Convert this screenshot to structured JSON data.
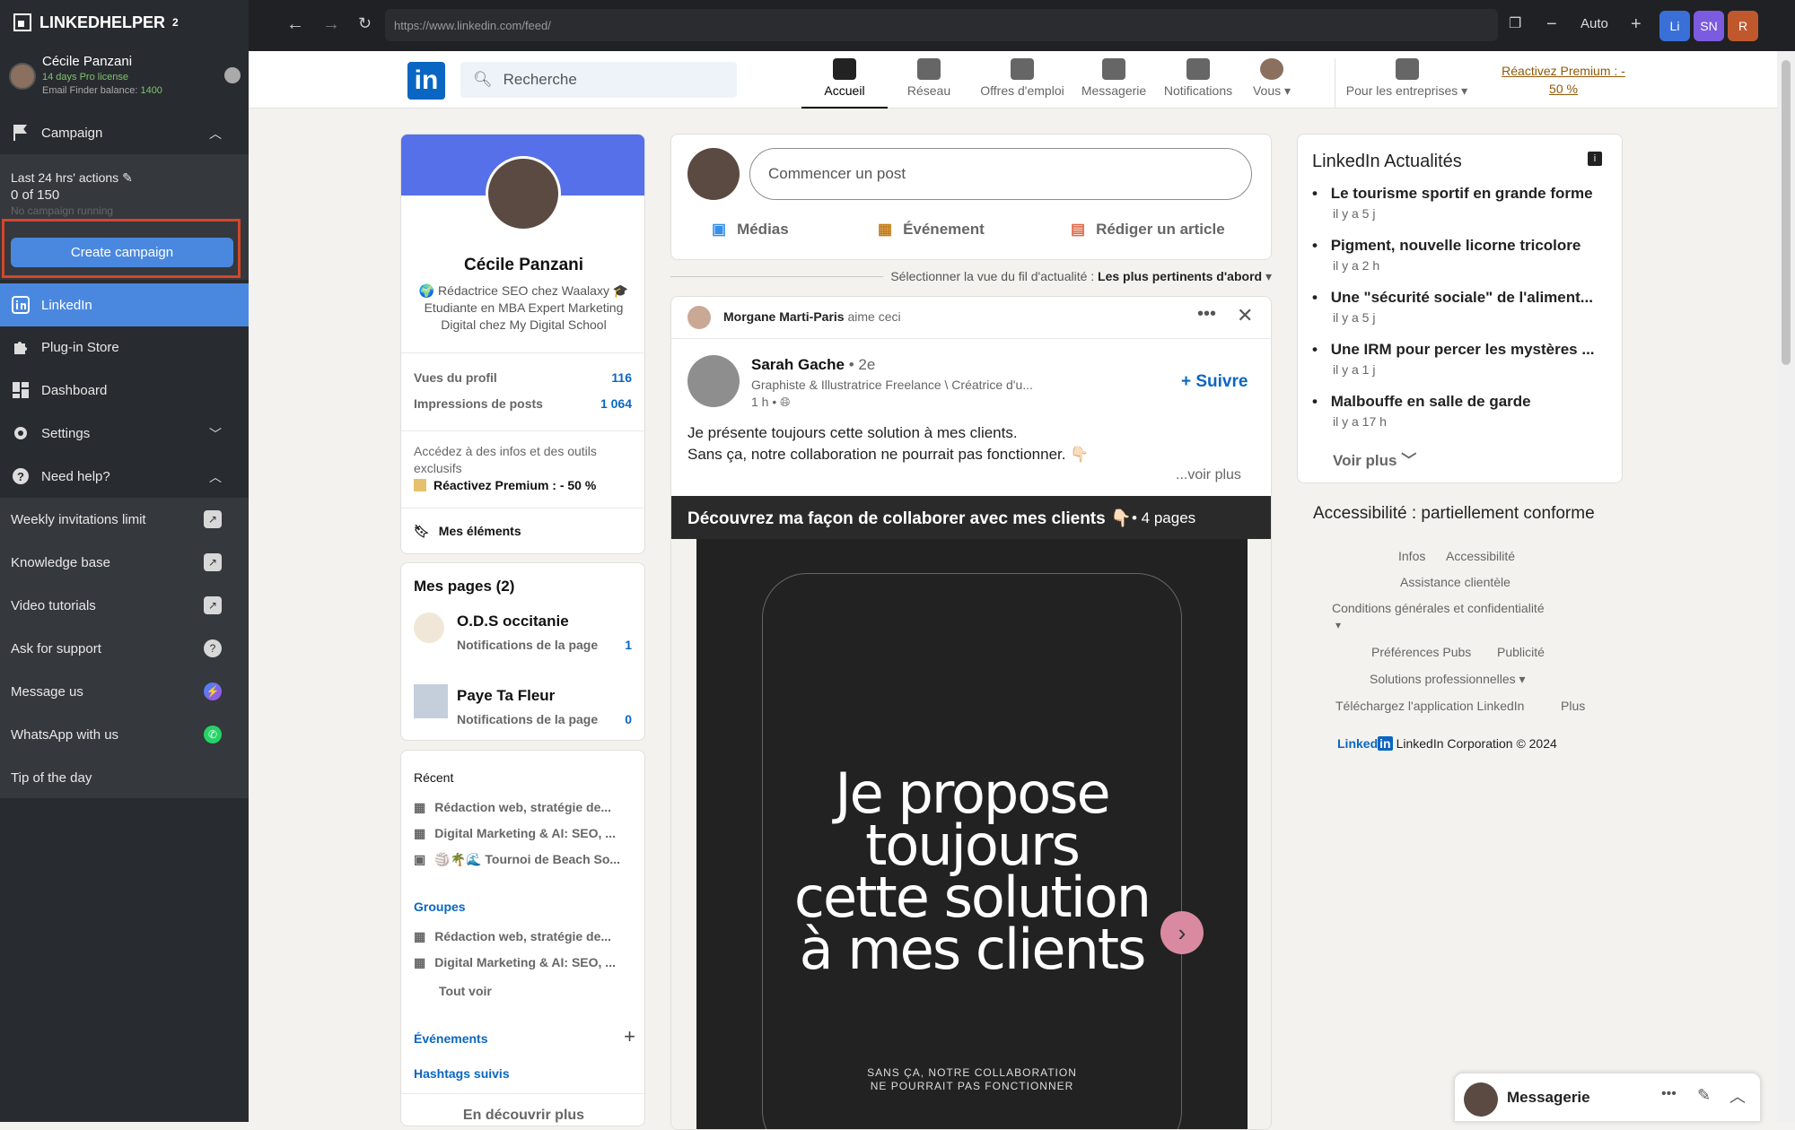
{
  "sidebar": {
    "brand": "LINKEDHELPER",
    "brand_sup": "2",
    "user_name": "Cécile Panzani",
    "license": "14 days Pro license",
    "balance_label": "Email Finder balance: ",
    "balance_value": "1400",
    "campaign_label": "Campaign",
    "stats_title": "Last 24 hrs' actions",
    "stats_count": "0 of 150",
    "stats_status": "No campaign running",
    "create_button": "Create campaign",
    "items": [
      {
        "label": "LinkedIn"
      },
      {
        "label": "Plug-in Store"
      },
      {
        "label": "Dashboard"
      },
      {
        "label": "Settings"
      },
      {
        "label": "Need help?"
      }
    ],
    "links": [
      {
        "label": "Weekly invitations limit"
      },
      {
        "label": "Knowledge base"
      },
      {
        "label": "Video tutorials"
      },
      {
        "label": "Ask for support"
      },
      {
        "label": "Message us"
      },
      {
        "label": "WhatsApp with us"
      },
      {
        "label": "Tip of the day"
      }
    ]
  },
  "browser": {
    "url": "https://www.linkedin.com/feed/",
    "zoom_mode": "Auto",
    "profiles": [
      "Li",
      "SN",
      "R"
    ],
    "profile_colors": [
      "#3a6fd8",
      "#7b5be0",
      "#c0582e"
    ]
  },
  "linkedin": {
    "search_placeholder": "Recherche",
    "nav": [
      "Accueil",
      "Réseau",
      "Offres d'emploi",
      "Messagerie",
      "Notifications",
      "Vous",
      "Pour les entreprises"
    ],
    "premium_cta": "Réactivez Premium : - 50 %",
    "profile": {
      "name": "Cécile Panzani",
      "headline": "🌍 Rédactrice SEO chez Waalaxy 🎓 Etudiante en MBA Expert Marketing Digital chez My Digital School",
      "stats": [
        {
          "label": "Vues du profil",
          "value": "116"
        },
        {
          "label": "Impressions de posts",
          "value": "1 064"
        }
      ],
      "premium_text": "Accédez à des infos et des outils exclusifs",
      "premium_link": "Réactivez Premium : - 50 %",
      "my_items": "Mes éléments"
    },
    "pages": {
      "title": "Mes pages (2)",
      "items": [
        {
          "name": "O.D.S occitanie",
          "sub": "Notifications de la page",
          "count": "1"
        },
        {
          "name": "Paye Ta Fleur",
          "sub": "Notifications de la page",
          "count": "0"
        }
      ]
    },
    "recent": {
      "title": "Récent",
      "items": [
        "Rédaction web, stratégie de...",
        "Digital Marketing & AI: SEO, ...",
        "🏐🌴🌊 Tournoi de Beach So..."
      ],
      "groups_title": "Groupes",
      "groups": [
        "Rédaction web, stratégie de...",
        "Digital Marketing & AI: SEO, ..."
      ],
      "see_all": "Tout voir",
      "events": "Événements",
      "hashtags": "Hashtags suivis",
      "discover": "En découvrir plus"
    },
    "composer": {
      "placeholder": "Commencer un post",
      "media": "Médias",
      "event": "Événement",
      "article": "Rédiger un article"
    },
    "sort": {
      "label": "Sélectionner la vue du fil d'actualité : ",
      "value": "Les plus pertinents d'abord"
    },
    "post": {
      "liker": "Morgane Marti-Paris",
      "liker_action": " aime ceci",
      "author": "Sarah Gache",
      "degree": "• 2e",
      "author_headline": "Graphiste & Illustratrice Freelance \\ Créatrice d'u...",
      "time": "1 h •",
      "follow": "+ Suivre",
      "text_line1": "Je présente toujours cette solution à mes clients.",
      "text_line2": "Sans ça, notre collaboration ne pourrait pas fonctionner. 👇🏻",
      "see_more": "...voir plus",
      "doc_title": "Découvrez ma façon de collaborer avec mes clients 👇🏻",
      "doc_pages": " • 4 pages",
      "slide_line1": "Je propose",
      "slide_line2": "toujours",
      "slide_line3": "cette solution",
      "slide_line4": "à mes clients",
      "slide_small1": "SANS ÇA, NOTRE COLLABORATION",
      "slide_small2": "NE POURRAIT PAS FONCTIONNER"
    },
    "news": {
      "title": "LinkedIn Actualités",
      "items": [
        {
          "title": "Le tourisme sportif en grande forme",
          "age": "il y a 5 j"
        },
        {
          "title": "Pigment, nouvelle licorne tricolore",
          "age": "il y a 2 h"
        },
        {
          "title": "Une \"sécurité sociale\" de l'aliment...",
          "age": "il y a 5 j"
        },
        {
          "title": "Une IRM pour percer les mystères ...",
          "age": "il y a 1 j"
        },
        {
          "title": "Malbouffe en salle de garde",
          "age": "il y a 17 h"
        }
      ],
      "more": "Voir plus"
    },
    "footer": {
      "accessibility": "Accessibilité : partiellement conforme",
      "links": [
        "Infos",
        "Accessibilité",
        "Assistance clientèle",
        "Conditions générales et confidentialité",
        "Préférences Pubs",
        "Publicité",
        "Solutions professionnelles",
        "Téléchargez l'application LinkedIn",
        "Plus"
      ],
      "brand": "Linked",
      "copyright": "LinkedIn Corporation © 2024"
    },
    "messaging": "Messagerie"
  }
}
